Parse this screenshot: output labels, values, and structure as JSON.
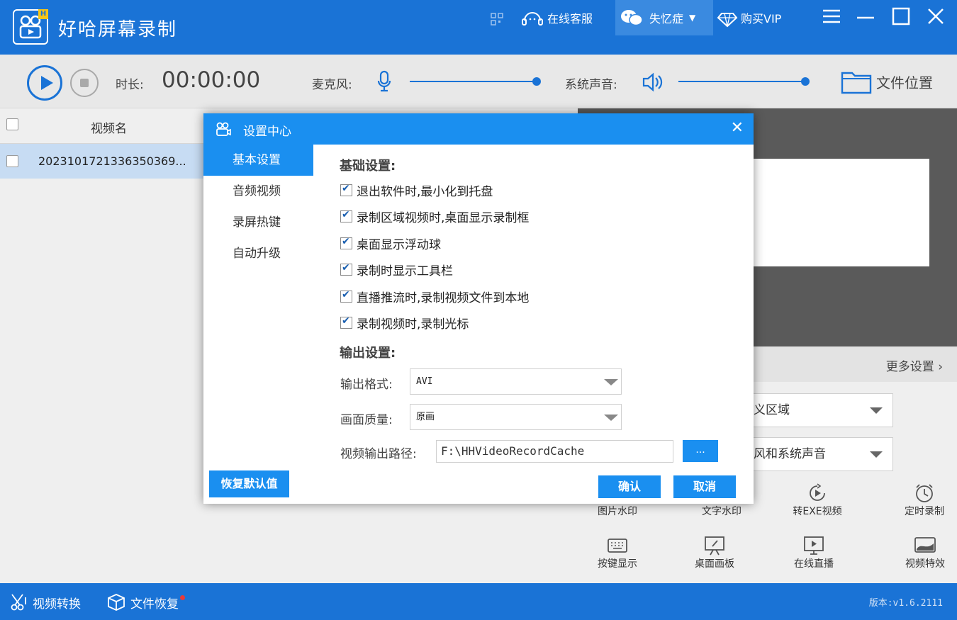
{
  "window": {
    "app_title": "好哈屏幕录制",
    "logo_badge": "H",
    "online_service": "在线客服",
    "user_name": "失忆症",
    "buy_vip": "购买VIP"
  },
  "toolbar": {
    "duration_label": "时长:",
    "duration_value": "00:00:00",
    "mic_label": "麦克风:",
    "mic_level": 1.0,
    "system_sound_label": "系统声音:",
    "system_sound_level": 1.0,
    "file_location": "文件位置"
  },
  "list": {
    "column_header": "视频名",
    "rows": [
      {
        "name": "2023101721336350369..."
      }
    ]
  },
  "right_panel": {
    "more_settings": "更多设置",
    "record_area_select": "义区域",
    "audio_select": "风和系统声音",
    "tools_row1": [
      "图片水印",
      "文字水印",
      "转EXE视频",
      "定时录制"
    ],
    "tools_row2": [
      "按键显示",
      "桌面画板",
      "在线直播",
      "视频特效"
    ]
  },
  "statusbar": {
    "video_convert": "视频转换",
    "file_recovery": "文件恢复",
    "version": "版本:v1.6.2111"
  },
  "dialog": {
    "title": "设置中心",
    "nav": [
      "基本设置",
      "音频视频",
      "录屏热键",
      "自动升级"
    ],
    "active_nav": "基本设置",
    "basic_title": "基础设置:",
    "options": [
      {
        "label": "退出软件时,最小化到托盘",
        "checked": true
      },
      {
        "label": "录制区域视频时,桌面显示录制框",
        "checked": true
      },
      {
        "label": "桌面显示浮动球",
        "checked": true
      },
      {
        "label": "录制时显示工具栏",
        "checked": true
      },
      {
        "label": "直播推流时,录制视频文件到本地",
        "checked": true
      },
      {
        "label": "录制视频时,录制光标",
        "checked": true
      }
    ],
    "output_title": "输出设置:",
    "format_label": "输出格式:",
    "format_value": "AVI",
    "quality_label": "画面质量:",
    "quality_value": "原画",
    "path_label": "视频输出路径:",
    "path_value": "F:\\HHVideoRecordCache",
    "browse_label": "...",
    "restore_default": "恢复默认值",
    "confirm": "确认",
    "cancel": "取消"
  },
  "colors": {
    "brand_blue": "#1a73d6",
    "dialog_blue": "#1a8ff0",
    "selected_row": "#c7dcf3"
  }
}
